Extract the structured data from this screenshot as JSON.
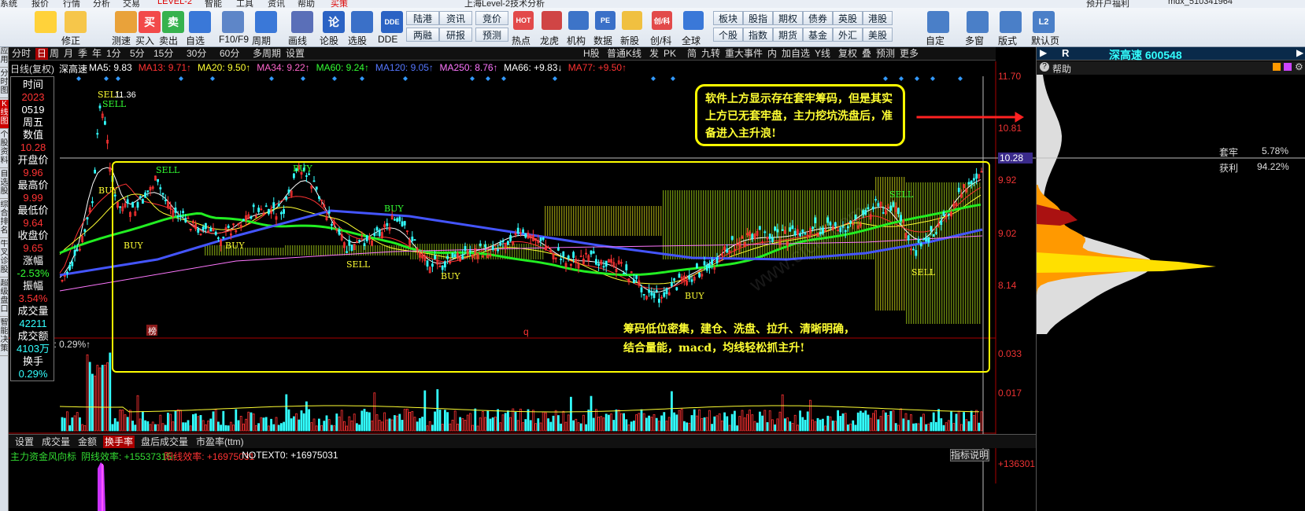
{
  "menu": [
    {
      "label": "系统"
    },
    {
      "label": "报价"
    },
    {
      "label": "行情"
    },
    {
      "label": "分析"
    },
    {
      "label": "交易"
    },
    {
      "label": "LEVEL-2",
      "red": true
    },
    {
      "label": "智能"
    },
    {
      "label": "工具"
    },
    {
      "label": "资讯"
    },
    {
      "label": "帮助"
    },
    {
      "label": "买策",
      "red": true
    },
    {
      "label": "上海Level-2技术分析"
    },
    {
      "label": "预开户福利"
    },
    {
      "label": "mdx_510341964"
    }
  ],
  "toolbar": {
    "big_buttons": [
      {
        "label": "",
        "icon": "back-arrow-icon"
      },
      {
        "label": "修正",
        "icon": "up-down-arrows-icon"
      },
      {
        "label": "测速",
        "icon": "stopwatch-icon"
      },
      {
        "label": "买入",
        "icon": "buy-icon",
        "glyph": "买"
      },
      {
        "label": "卖出",
        "icon": "sell-icon",
        "glyph": "卖"
      },
      {
        "label": "自选",
        "icon": "star-list-icon"
      },
      {
        "label": "F10/F9",
        "icon": "document-icon"
      },
      {
        "label": "周期",
        "icon": "clock-icon"
      },
      {
        "label": "画线",
        "icon": "pen-icon"
      },
      {
        "label": "论股",
        "icon": "forum-icon",
        "glyph": "论"
      },
      {
        "label": "选股",
        "icon": "magnifier-chart-icon"
      },
      {
        "label": "DDE",
        "icon": "dde-icon",
        "glyph": "DDE"
      }
    ],
    "grid_buttons": [
      [
        "陆港",
        "资讯",
        "竞价"
      ],
      [
        "两融",
        "研报",
        "预测"
      ]
    ],
    "mid_buttons": [
      {
        "label": "热点",
        "icon": "hot-icon",
        "glyph": "HOT"
      },
      {
        "label": "龙虎",
        "icon": "dragon-tiger-icon"
      },
      {
        "label": "机构",
        "icon": "bank-icon"
      },
      {
        "label": "数据",
        "icon": "pe-data-icon",
        "glyph": "PE"
      },
      {
        "label": "新股",
        "icon": "new-stock-icon"
      },
      {
        "label": "创/科",
        "icon": "innovation-icon",
        "glyph": "创/科"
      },
      {
        "label": "全球",
        "icon": "globe-icon"
      }
    ],
    "grid2_buttons": [
      [
        "板块",
        "股指",
        "期权",
        "债券",
        "英股",
        "港股"
      ],
      [
        "个股",
        "指数",
        "期货",
        "基金",
        "外汇",
        "美股"
      ]
    ],
    "right_buttons": [
      {
        "label": "自定",
        "icon": "custom-icon"
      },
      {
        "label": "多窗",
        "icon": "multi-window-icon"
      },
      {
        "label": "版式",
        "icon": "layout-icon"
      },
      {
        "label": "默认页",
        "icon": "l2-home-icon",
        "glyph": "L2"
      }
    ]
  },
  "left_tabs": [
    "应用",
    "分时图",
    "K线图",
    "个股资料",
    "自选股",
    "综合排名",
    "牛叉诊股",
    "超级盘口",
    "智能决策"
  ],
  "period_bar": [
    "分时",
    "日",
    "周",
    "月",
    "季",
    "年",
    "1分",
    "5分",
    "15分",
    "30分",
    "60分",
    "多周期",
    "设置"
  ],
  "period_active": "日",
  "period_right": [
    "H股",
    "普通K线",
    "发",
    "PK",
    "简",
    "九转",
    "重大事件",
    "内",
    "加自选",
    "Y线",
    "复权",
    "叠",
    "预测",
    "更多"
  ],
  "ma_line": {
    "prefix": "日线(复权)",
    "name": "深高速",
    "items": [
      {
        "text": "MA5: 9.83",
        "color": "#ffffff"
      },
      {
        "text": "MA13: 9.71↑",
        "color": "#ff3333"
      },
      {
        "text": "MA20: 9.50↑",
        "color": "#ffff33"
      },
      {
        "text": "MA34: 9.22↑",
        "color": "#ff66cc"
      },
      {
        "text": "MA60: 9.24↑",
        "color": "#33ff33"
      },
      {
        "text": "MA120: 9.05↑",
        "color": "#5577ff"
      },
      {
        "text": "MA250: 8.76↑",
        "color": "#ff77ff"
      },
      {
        "text": "MA66: +9.83↓",
        "color": "#ffffff"
      },
      {
        "text": "MA77: +9.50↑",
        "color": "#ff3333"
      }
    ]
  },
  "info_panel": [
    {
      "label": "时间",
      "value": "2023",
      "value2": "0519"
    },
    {
      "label": "周五",
      "value": ""
    },
    {
      "label": "数值",
      "value": "10.28"
    },
    {
      "label": "开盘价",
      "value": "9.96"
    },
    {
      "label": "最高价",
      "value": "9.99"
    },
    {
      "label": "最低价",
      "value": "9.64"
    },
    {
      "label": "收盘价",
      "value": "9.65"
    },
    {
      "label": "涨幅",
      "value": "-2.53%"
    },
    {
      "label": "振幅",
      "value": "3.54%"
    },
    {
      "label": "成交量",
      "value": "42211"
    },
    {
      "label": "成交额",
      "value": "4103万"
    },
    {
      "label": "换手",
      "value": "0.29%"
    }
  ],
  "price_axis": [
    "11.70",
    "10.81",
    "10.28",
    "9.92",
    "9.02",
    "8.14"
  ],
  "volume_axis": [
    "0.033",
    "0.017"
  ],
  "bottom_axis": "+136301",
  "chart_labels": {
    "peak_price": "11.36",
    "signals": [
      "SELL",
      "SELL",
      "BUY",
      "BUY",
      "SELL",
      "BUY",
      "BUY",
      "SELL",
      "BUY",
      "BUY",
      "SELL",
      "BUY",
      "SELL"
    ],
    "bang": "榜",
    "q": "q",
    "mavol": "MAVOL60: 0.29%↑"
  },
  "notes": {
    "top": "软件上方显示存在套牢筹码，但是其实上方已无套牢盘，主力挖坑洗盘后，准备进入主升浪!",
    "bottom1": "筹码低位密集，建仓、洗盘、拉升、清晰明确，",
    "bottom2": "结合量能，macd，均线轻松抓主升!",
    "watermark": "www.cfchi.com"
  },
  "bottom_tabs": [
    "设置",
    "成交量",
    "金额",
    "换手率",
    "盘后成交量",
    "市盈率(ttm)"
  ],
  "bottom_tab_active": "换手率",
  "indicator_line": {
    "label": "主力资金风向标",
    "items": [
      {
        "text": "阴线效率: +15537315↑",
        "color": "#33dd33"
      },
      {
        "text": "阳线效率: +16975031",
        "color": "#ff3333"
      },
      {
        "text": "NOTEXT0: +16975031",
        "color": "#ffffff"
      }
    ],
    "explain_button": "指标说明"
  },
  "right_panel": {
    "tab": "R",
    "title": "深高速 600548",
    "help": "帮助",
    "trapped_label": "套牢",
    "trapped_value": "5.78%",
    "profit_label": "获利",
    "profit_value": "94.22%"
  },
  "colors": {
    "up": "#ff3333",
    "down": "#33ffff",
    "ma5": "#ffffff",
    "ma20": "#ffff33",
    "ma60": "#22ee22",
    "ma120": "#4455ff",
    "frame": "#ffff00",
    "axis": "#ff3333"
  }
}
